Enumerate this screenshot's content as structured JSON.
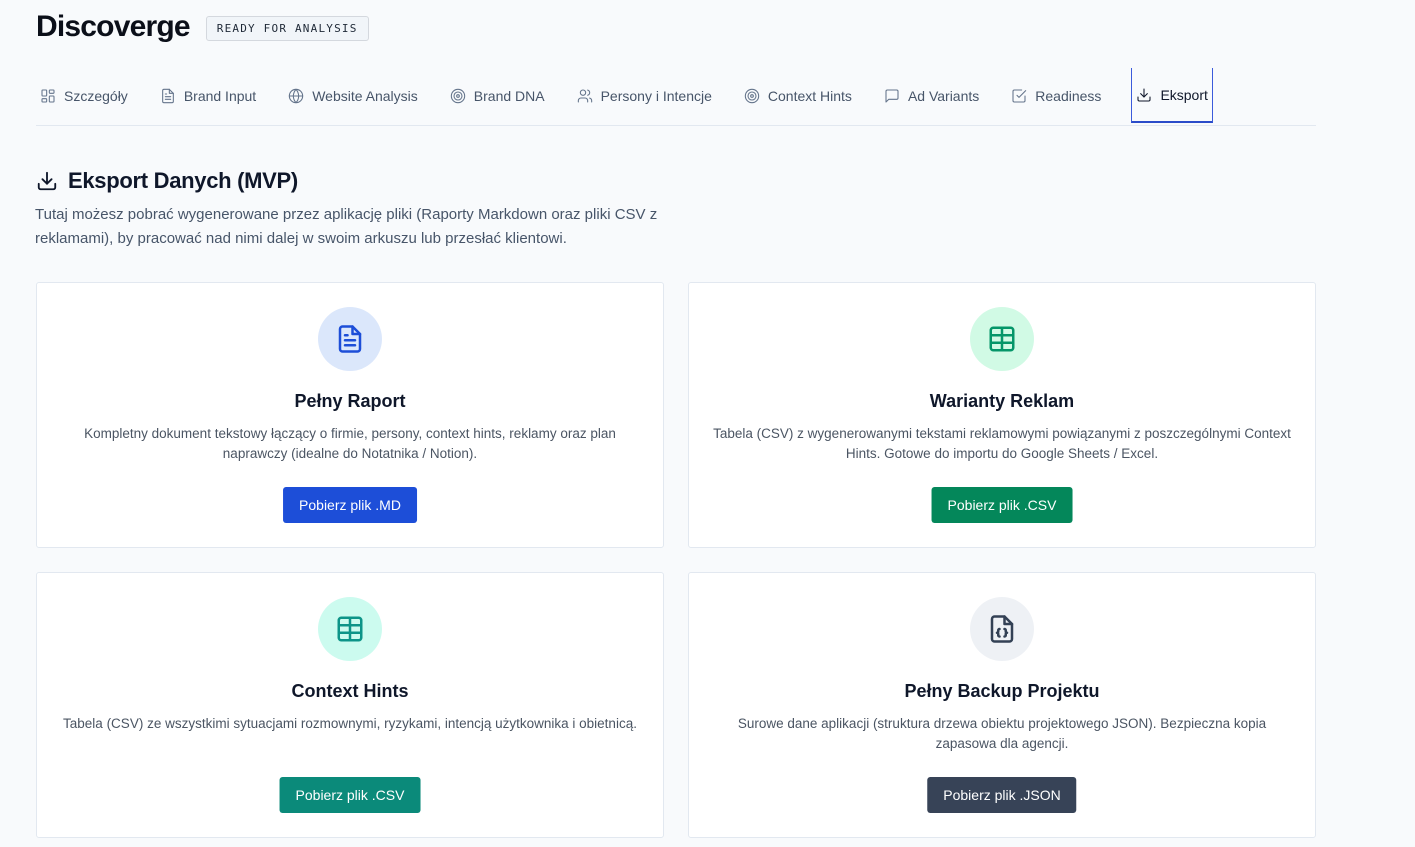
{
  "app": {
    "title": "Discoverge",
    "status": "READY FOR ANALYSIS"
  },
  "tabs": [
    {
      "label": "Szczegóły",
      "icon": "layout-grid-icon"
    },
    {
      "label": "Brand Input",
      "icon": "file-text-icon"
    },
    {
      "label": "Website Analysis",
      "icon": "globe-icon"
    },
    {
      "label": "Brand DNA",
      "icon": "target-icon"
    },
    {
      "label": "Persony i Intencje",
      "icon": "users-icon"
    },
    {
      "label": "Context Hints",
      "icon": "target-icon"
    },
    {
      "label": "Ad Variants",
      "icon": "message-square-icon"
    },
    {
      "label": "Readiness",
      "icon": "check-square-icon"
    },
    {
      "label": "Eksport",
      "icon": "download-icon",
      "active": true
    }
  ],
  "section": {
    "title": "Eksport Danych (MVP)",
    "description": "Tutaj możesz pobrać wygenerowane przez aplikację pliki (Raporty Markdown oraz pliki CSV z reklamami), by pracować nad nimi dalej w swoim arkuszu lub przesłać klientowi."
  },
  "cards": [
    {
      "title": "Pełny Raport",
      "description": "Kompletny dokument tekstowy łączący o firmie, persony, context hints, reklamy oraz plan naprawczy (idealne do Notatnika / Notion).",
      "button": "Pobierz plik .MD",
      "icon": "file-text-icon",
      "icon_bg": "#dbe7fb",
      "icon_color": "#1d4ed8",
      "button_color": "#1d4ed8"
    },
    {
      "title": "Warianty Reklam",
      "description": "Tabela (CSV) z wygenerowanymi tekstami reklamowymi powiązanymi z poszczególnymi Context Hints. Gotowe do importu do Google Sheets / Excel.",
      "button": "Pobierz plik .CSV",
      "icon": "table-icon",
      "icon_bg": "#d1fae5",
      "icon_color": "#059669",
      "button_color": "#04875a"
    },
    {
      "title": "Context Hints",
      "description": "Tabela (CSV) ze wszystkimi sytuacjami rozmownymi, ryzykami, intencją użytkownika i obietnicą.",
      "button": "Pobierz plik .CSV",
      "icon": "table-icon",
      "icon_bg": "#ccfbef",
      "icon_color": "#0d9488",
      "button_color": "#0b8a7a"
    },
    {
      "title": "Pełny Backup Projektu",
      "description": "Surowe dane aplikacji (struktura drzewa obiektu projektowego JSON). Bezpieczna kopia zapasowa dla agencji.",
      "button": "Pobierz plik .JSON",
      "icon": "file-json-icon",
      "icon_bg": "#eef1f5",
      "icon_color": "#334155",
      "button_color": "#374357"
    }
  ]
}
